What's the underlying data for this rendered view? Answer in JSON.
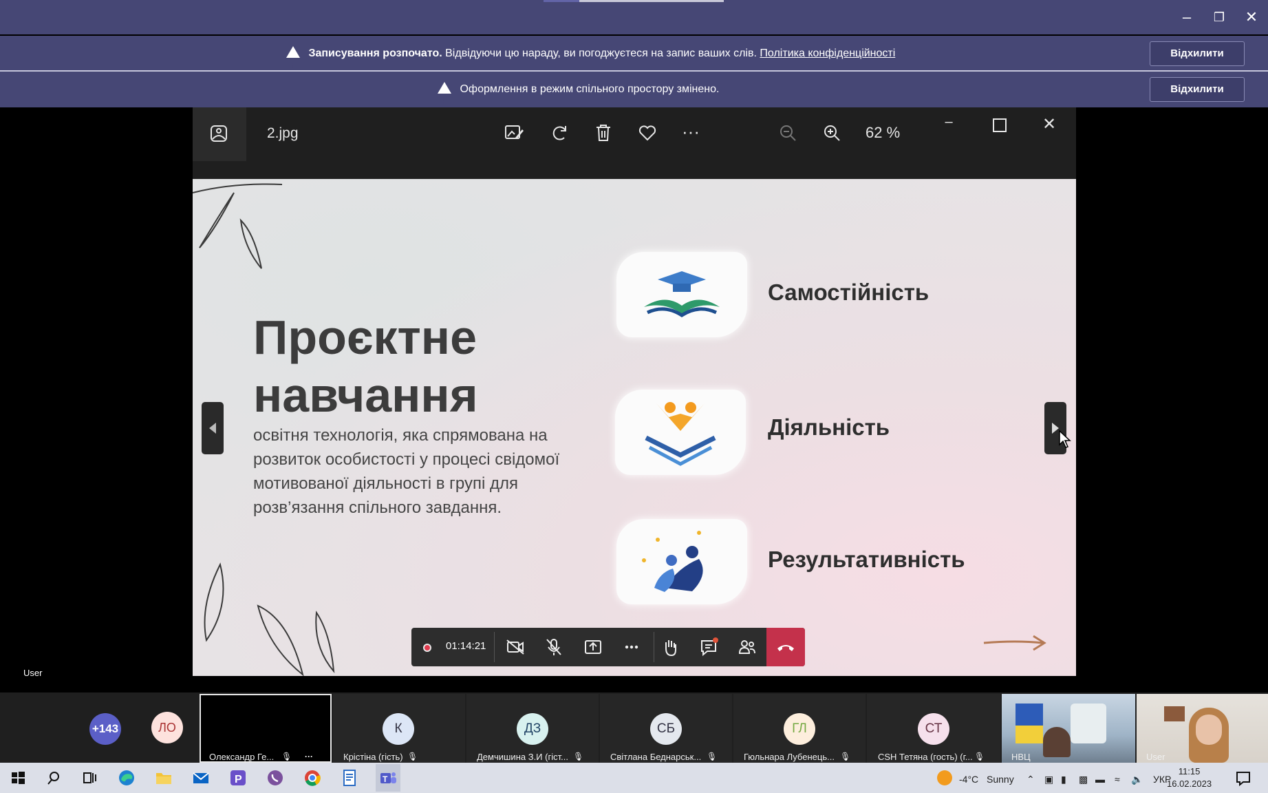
{
  "banners": {
    "recording": {
      "bold": "Записування розпочато.",
      "text": "Відвідуючи цю нараду, ви погоджуєтеся на запис ваших слів.",
      "link": "Політика конфіденційності",
      "dismiss": "Відхилити"
    },
    "layout": {
      "text": "Оформлення в режим спільного простору змінено.",
      "dismiss": "Відхилити"
    }
  },
  "viewer": {
    "file_name": "2.jpg",
    "zoom": "62 %",
    "more": "···"
  },
  "slide": {
    "title_line1": "Проєктне",
    "title_line2": "навчання",
    "description": "освітня технологія, яка спрямована на розвиток особистості у процесі свідомої мотивованої діяльності в групі для розв’язання спільного завдання.",
    "features": [
      "Самостійність",
      "Діяльність",
      "Результативність"
    ]
  },
  "call": {
    "timer": "01:14:21"
  },
  "self_view_label": "User",
  "participants": {
    "overflow": "+143",
    "lo_initials": "ЛО",
    "tiles": [
      {
        "name": "Олександр Ге...",
        "initials": ""
      },
      {
        "name": "Крістіна (гість)",
        "initials": "К"
      },
      {
        "name": "Демчишина З.И (гіст...",
        "initials": "ДЗ"
      },
      {
        "name": "Світлана Беднарськ...",
        "initials": "СБ"
      },
      {
        "name": "Гюльнара Лубенець...",
        "initials": "ГЛ"
      },
      {
        "name": "CSH Тетяна (гость) (г...",
        "initials": "СТ"
      },
      {
        "name": "НВЦ",
        "initials": ""
      },
      {
        "name": "User",
        "initials": ""
      }
    ]
  },
  "taskbar": {
    "weather_temp": "-4°C",
    "weather_text": "Sunny",
    "language": "УКР",
    "time": "11:15",
    "date": "16.02.2023"
  },
  "colors": {
    "teams_purple": "#464775",
    "leave_red": "#c4314b",
    "record_red": "#e03a4e"
  }
}
